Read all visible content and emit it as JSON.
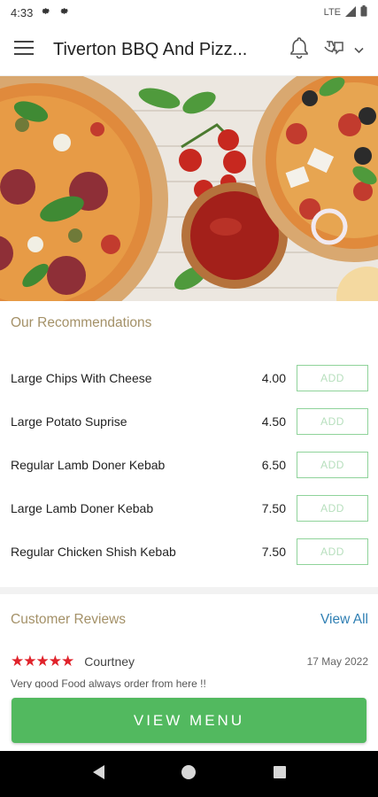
{
  "status_bar": {
    "time": "4:33",
    "network": "LTE"
  },
  "header": {
    "title": "Tiverton BBQ And Pizz..."
  },
  "recommendations": {
    "title": "Our Recommendations",
    "add_label": "ADD",
    "items": [
      {
        "name": "Large Chips With Cheese",
        "price": "4.00"
      },
      {
        "name": "Large Potato Suprise",
        "price": "4.50"
      },
      {
        "name": "Regular Lamb Doner Kebab",
        "price": "6.50"
      },
      {
        "name": "Large Lamb Doner Kebab",
        "price": "7.50"
      },
      {
        "name": "Regular Chicken Shish Kebab",
        "price": "7.50"
      }
    ]
  },
  "reviews": {
    "title": "Customer Reviews",
    "view_all": "View All",
    "items": [
      {
        "stars": "★★★★★",
        "rating": 5,
        "author": "Courtney",
        "date": "17 May 2022",
        "text": "Very good Food always order from here !!"
      }
    ]
  },
  "cta": {
    "label": "VIEW MENU"
  },
  "colors": {
    "accent_green": "#52b95f",
    "gold_text": "#a49168",
    "link_blue": "#2f7fb3",
    "star_red": "#e0232b"
  }
}
